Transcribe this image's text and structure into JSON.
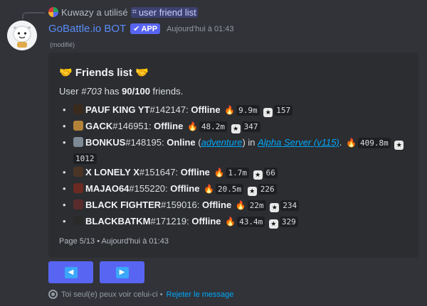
{
  "reply": {
    "user": "Kuwazy",
    "action": "a utilisé",
    "command_icon": "slash-command-icon",
    "command": "user friend list"
  },
  "message": {
    "author": "GoBattle.io BOT",
    "badge": "APP",
    "timestamp": "Aujourd'hui à 01:43",
    "edited": "(modifié)"
  },
  "embed": {
    "title": "Friends list",
    "title_icon": "handshake-icon",
    "description": {
      "prefix": "User ",
      "user_id": "#703",
      "middle": " has ",
      "count": "90/100",
      "suffix": " friends."
    },
    "friends": [
      {
        "name": "PAUF KING YT",
        "id": "#142147",
        "sep": ": ",
        "status": "Offline",
        "gold": "9.9m",
        "level": "157",
        "avatar_color": "#3a2a1d"
      },
      {
        "name": "GACK",
        "id": "#146951",
        "sep": ": ",
        "status": "Offline",
        "gold": "48.2m",
        "level": "347",
        "avatar_color": "#b4833a"
      },
      {
        "name": "BONKUS",
        "id": "#148195",
        "sep": ": ",
        "status": "Online",
        "mode_open": " (",
        "mode": "adventure",
        "mode_close": ") in ",
        "server": "Alpha Server (v115)",
        "server_end": ".",
        "gold": "409.8m",
        "level": "1012",
        "avatar_color": "#7d8a96"
      },
      {
        "name": "X LONELY X",
        "id": "#151647",
        "sep": ": ",
        "status": "Offline",
        "gold": "1.7m",
        "level": "66",
        "avatar_color": "#4a3426"
      },
      {
        "name": "MAJAO64",
        "id": "#155220",
        "sep": ": ",
        "status": "Offline",
        "gold": "20.5m",
        "level": "226",
        "avatar_color": "#6b2a22"
      },
      {
        "name": "BLACK FIGHTER",
        "id": "#159016",
        "sep": ": ",
        "status": "Offline",
        "gold": "22m",
        "level": "234",
        "avatar_color": "#5a2b2b"
      },
      {
        "name": "BLACKBATKM",
        "id": "#171219",
        "sep": ": ",
        "status": "Offline",
        "gold": "43.4m",
        "level": "329",
        "avatar_color": "#2a2a2a"
      }
    ],
    "footer": "Page 5/13 • Aujourd'hui à 01:43"
  },
  "buttons": {
    "prev_icon": "◀",
    "next_icon": "▶"
  },
  "ephemeral": {
    "text": "Toi seul(e) peux voir celui-ci • ",
    "dismiss": "Rejeter le message"
  }
}
